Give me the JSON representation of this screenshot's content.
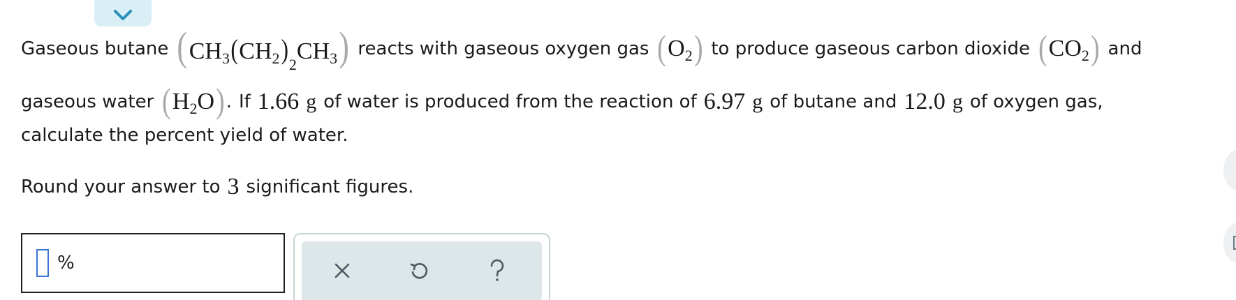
{
  "problem": {
    "t_gaseous_butane": "Gaseous butane",
    "t_reacts": "reacts with gaseous oxygen gas",
    "t_to_produce": "to produce gaseous carbon dioxide",
    "t_and": "and",
    "t_gaseous_water": "gaseous water",
    "t_period": ".",
    "t_if": "If",
    "v_water_mass": "1.66",
    "u_g": "g",
    "t_of_water": "of water is produced from the reaction of",
    "v_butane_mass": "6.97",
    "t_of_butane": "of butane and",
    "v_oxygen_mass": "12.0",
    "t_of_oxygen": "of oxygen gas,",
    "t_calculate": "calculate the percent yield of water.",
    "t_round": "Round your answer to",
    "v_sigfigs": "3",
    "t_sigfigs": "significant figures."
  },
  "formulas": {
    "CH": "CH",
    "H": "H",
    "O": "O",
    "CO": "CO",
    "sub_3": "3",
    "sub_2": "2"
  },
  "answer": {
    "value": "",
    "unit": "%"
  },
  "icons": {
    "collapse": "chevron-down-icon",
    "clear": "close-icon",
    "undo": "undo-icon",
    "help": "help-icon"
  },
  "colors": {
    "accent_tab": "#d9eef5",
    "toolbar_bg": "#dde6e9",
    "icon_color": "#4a5a63",
    "cursor": "#3a75d6",
    "parens": "#a8a8a8"
  }
}
